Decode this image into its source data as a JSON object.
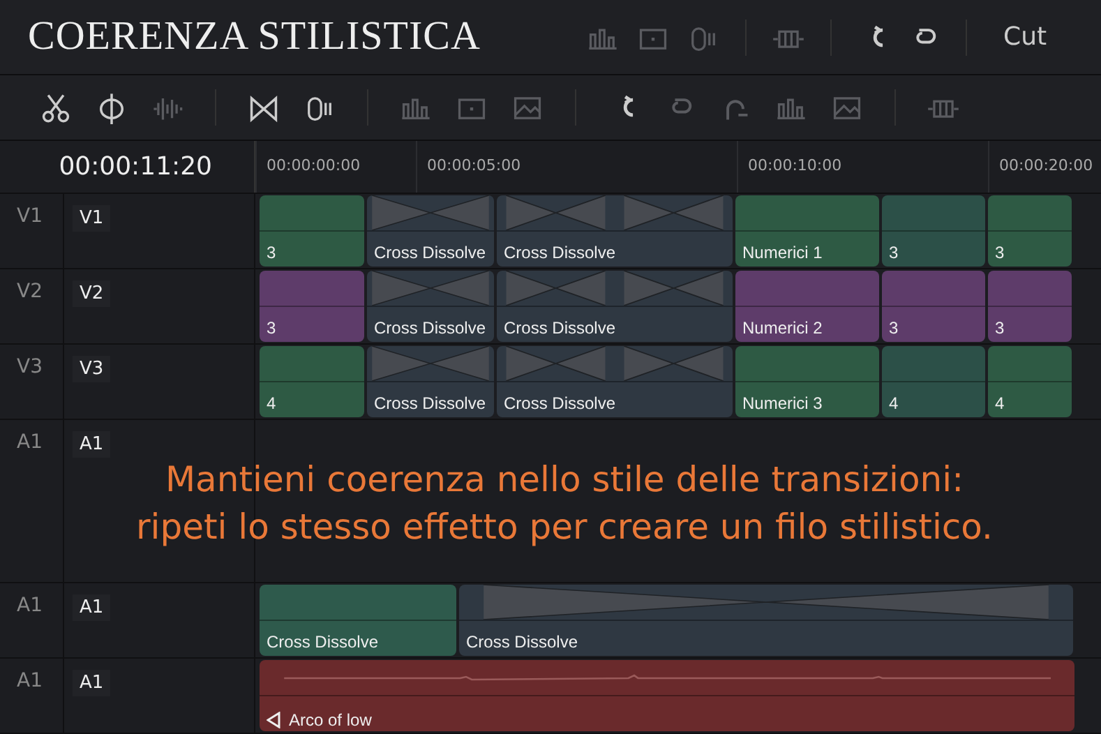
{
  "title": "COERENZA STILISTICA",
  "header_tools": [
    {
      "kind": "bars",
      "dim": true
    },
    {
      "kind": "frame",
      "dim": true
    },
    {
      "kind": "clipper",
      "dim": true
    },
    {
      "kind": "strip",
      "dim": true
    },
    {
      "kind": "link",
      "dim": false
    },
    {
      "kind": "unlink",
      "dim": false
    }
  ],
  "header_label": "Cut",
  "toolbar": [
    {
      "kind": "scissors",
      "dim": false
    },
    {
      "kind": "blade",
      "dim": false
    },
    {
      "kind": "wave",
      "dim": true
    },
    {
      "kind": "bowtie",
      "dim": false
    },
    {
      "kind": "clipper",
      "dim": false
    },
    {
      "kind": "bars",
      "dim": true
    },
    {
      "kind": "frame",
      "dim": true
    },
    {
      "kind": "image",
      "dim": true
    },
    {
      "kind": "link",
      "dim": false
    },
    {
      "kind": "unlink",
      "dim": true
    },
    {
      "kind": "hook",
      "dim": true
    },
    {
      "kind": "bars",
      "dim": true
    },
    {
      "kind": "image",
      "dim": true
    },
    {
      "kind": "strip",
      "dim": true
    }
  ],
  "timecode": "00:00:11:20",
  "ruler": [
    "00:00:00:00",
    "00:00:05:00",
    "00:00:10:00",
    "00:00:20:00"
  ],
  "video_tracks": [
    {
      "name": "V1",
      "label": "V1",
      "clips": [
        {
          "kind": "clip",
          "label": "3",
          "color": "#2e5a44"
        },
        {
          "kind": "transition",
          "label": "Cross Dissolve"
        },
        {
          "kind": "transition",
          "label": "Cross Dissolve"
        },
        {
          "kind": "clip",
          "label": "Numerici 1",
          "color": "#2e5a44"
        },
        {
          "kind": "clip",
          "label": "3",
          "color": "#2c5048"
        },
        {
          "kind": "clip",
          "label": "3",
          "color": "#2e5a44"
        }
      ]
    },
    {
      "name": "V2",
      "label": "V2",
      "clips": [
        {
          "kind": "clip",
          "label": "3",
          "color": "#5e3c6a"
        },
        {
          "kind": "transition",
          "label": "Cross Dissolve"
        },
        {
          "kind": "transition",
          "label": "Cross Dissolve"
        },
        {
          "kind": "clip",
          "label": "Numerici 2",
          "color": "#5e3c6a"
        },
        {
          "kind": "clip",
          "label": "3",
          "color": "#5e3c6a"
        },
        {
          "kind": "clip",
          "label": "3",
          "color": "#5e3c6a"
        }
      ]
    },
    {
      "name": "V3",
      "label": "V3",
      "clips": [
        {
          "kind": "clip",
          "label": "4",
          "color": "#2e5a44"
        },
        {
          "kind": "transition",
          "label": "Cross Dissolve"
        },
        {
          "kind": "transition",
          "label": "Cross Dissolve"
        },
        {
          "kind": "clip",
          "label": "Numerici 3",
          "color": "#2e5a44"
        },
        {
          "kind": "clip",
          "label": "4",
          "color": "#2c5048"
        },
        {
          "kind": "clip",
          "label": "4",
          "color": "#2e5a44"
        }
      ]
    }
  ],
  "caption_track": {
    "name": "A1",
    "label": "A1",
    "caption": [
      "Mantieni coerenza nello stile delle transizioni:",
      "ripeti lo stesso effetto per creare un filo stilistico."
    ]
  },
  "audio_tracks": [
    {
      "name": "A1",
      "label": "A1",
      "clips": [
        {
          "kind": "clip",
          "label": "Cross Dissolve",
          "color": "#2e5a4c"
        },
        {
          "kind": "transition",
          "label": "Cross Dissolve"
        }
      ]
    },
    {
      "name": "A1",
      "label": "A1",
      "clips": [
        {
          "kind": "audio",
          "label": "Arco of low",
          "color": "#6a2a2c"
        }
      ]
    }
  ]
}
